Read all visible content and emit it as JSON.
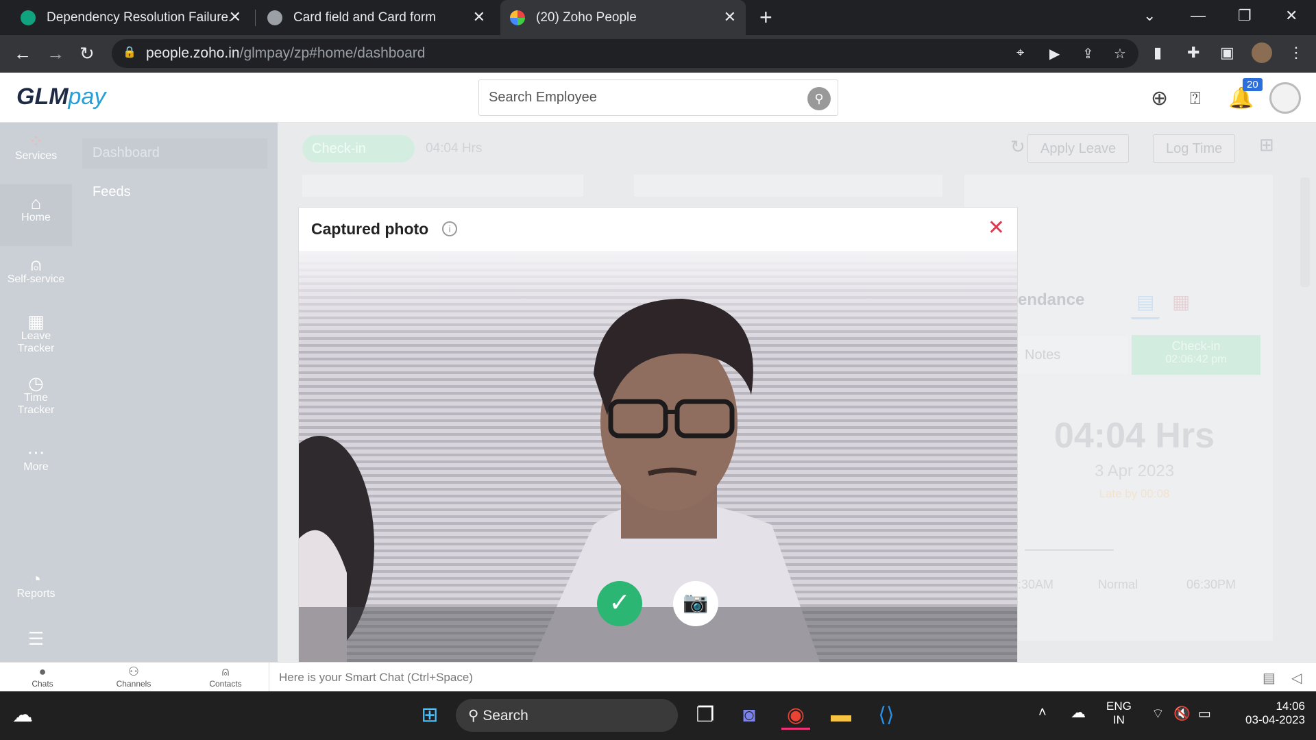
{
  "browser": {
    "tabs": [
      {
        "title": "Dependency Resolution Failure.",
        "icon": "openai-icon",
        "active": false
      },
      {
        "title": "Card field and Card form",
        "icon": "globe-icon",
        "active": false
      },
      {
        "title": "(20) Zoho People",
        "icon": "zoho-icon",
        "active": true
      }
    ],
    "url_host": "people.zoho.in",
    "url_path": "/glmpay/zp#home/dashboard"
  },
  "app": {
    "logo_main": "GLM",
    "logo_accent": "pay",
    "search_placeholder": "Search Employee",
    "notification_count": "20"
  },
  "sidebar": {
    "items": [
      {
        "label": "Services",
        "icon": "services-icon"
      },
      {
        "label": "Home",
        "icon": "home-icon"
      },
      {
        "label": "Self-service",
        "icon": "person-icon"
      },
      {
        "label": "Leave Tracker",
        "icon": "calendar-icon"
      },
      {
        "label": "Time Tracker",
        "icon": "clock-icon"
      },
      {
        "label": "More",
        "icon": "more-icon"
      },
      {
        "label": "Reports",
        "icon": "reports-icon"
      }
    ],
    "subnav": {
      "dashboard": "Dashboard",
      "feeds": "Feeds"
    }
  },
  "toolbar": {
    "checkin_label": "Check-in",
    "hours": "04:04 Hrs",
    "apply_leave": "Apply Leave",
    "log_time": "Log Time"
  },
  "attendance": {
    "title_partial": "endance",
    "notes_placeholder": "Notes",
    "checkin_label": "Check-in",
    "checkin_time": "02:06:42 pm",
    "total_hours": "04:04 Hrs",
    "date": "3 Apr 2023",
    "late": "Late by 00:08",
    "shift_start": ":30AM",
    "shift_name": "Normal",
    "shift_end": "06:30PM"
  },
  "modal": {
    "title": "Captured photo"
  },
  "chat": {
    "chats": "Chats",
    "channels": "Channels",
    "contacts": "Contacts",
    "placeholder": "Here is your Smart Chat (Ctrl+Space)"
  },
  "taskbar": {
    "search": "Search",
    "lang1": "ENG",
    "lang2": "IN",
    "time": "14:06",
    "date": "03-04-2023"
  }
}
